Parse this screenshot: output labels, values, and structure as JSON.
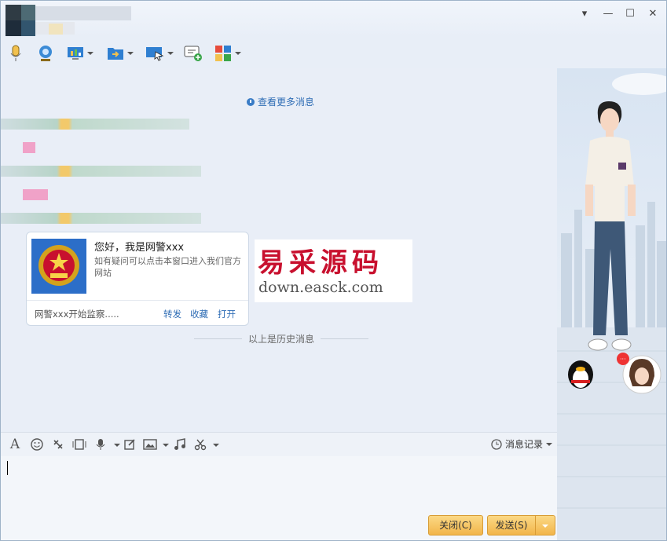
{
  "window": {
    "controls": {
      "menu": "▾",
      "minimize": "—",
      "maximize": "☐",
      "close": "✕"
    }
  },
  "toolbar": {
    "items": [
      "mic-icon",
      "camera-icon",
      "screen-share-icon",
      "file-transfer-icon",
      "remote-desktop-icon",
      "add-chat-icon",
      "apps-icon"
    ]
  },
  "chat": {
    "more_messages": "查看更多消息",
    "history_divider": "以上是历史消息",
    "card": {
      "title": "您好，我是网警xxx",
      "description": "如有疑问可以点击本窗口进入我们官方网站",
      "footer_text": "网警xxx开始监察.....",
      "forward": "转发",
      "collect": "收藏",
      "open": "打开"
    },
    "watermark": {
      "chinese": "易采源码",
      "url": "down.easck.com"
    }
  },
  "input_toolbar": {
    "font_icon": "A",
    "message_history": "消息记录"
  },
  "buttons": {
    "close": "关闭(C)",
    "send": "发送(S)"
  },
  "colors": {
    "accent_link": "#2f6db5",
    "button_gold": "#f2b54a",
    "police_blue": "#2c6ec8"
  }
}
